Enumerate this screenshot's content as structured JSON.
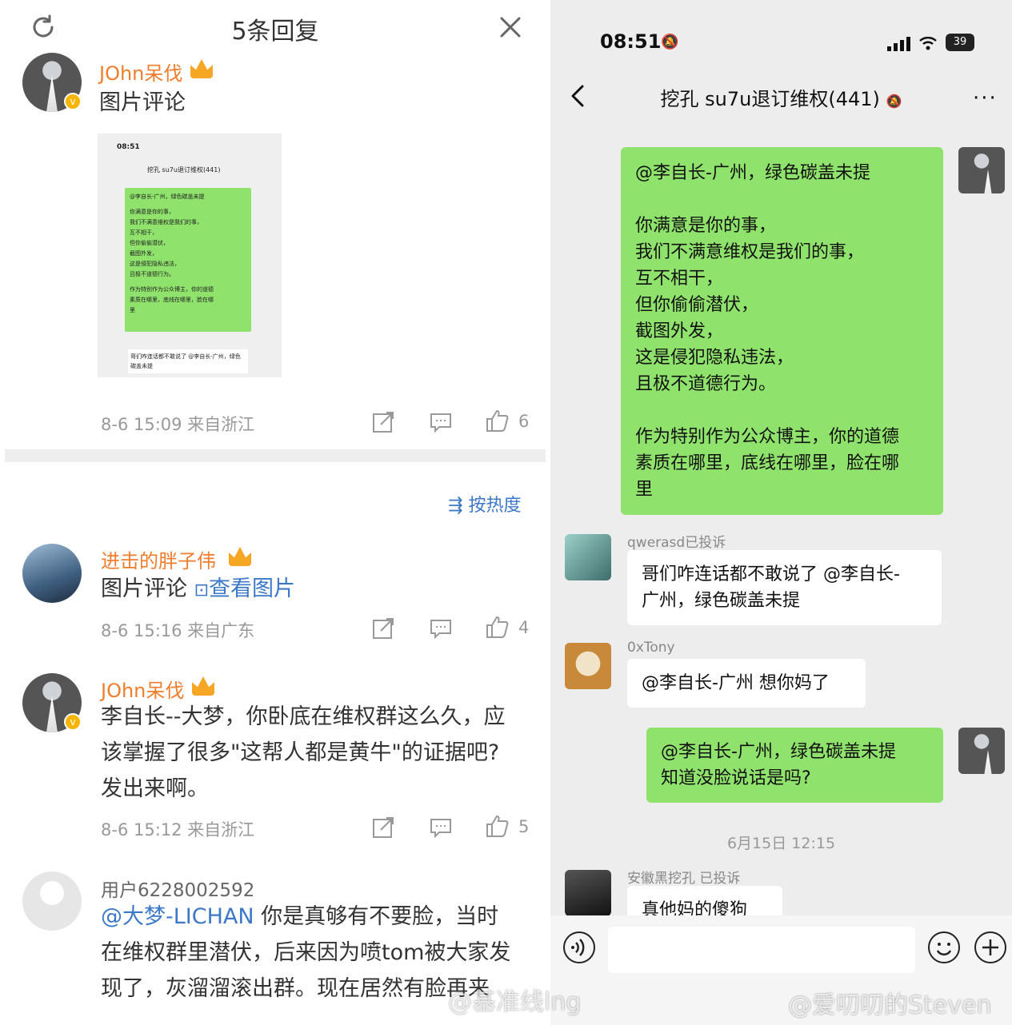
{
  "left": {
    "title": "5条回复",
    "sort_label": "按热度",
    "comments": [
      {
        "user": "JOhn呆伐",
        "text": "图片评论",
        "meta": "8-6 15:09  来自浙江",
        "likes": "6"
      },
      {
        "user": "进击的胖子伟",
        "text": "图片评论",
        "link": "查看图片",
        "meta": "8-6 15:16  来自广东",
        "likes": "4"
      },
      {
        "user": "JOhn呆伐",
        "lines": [
          "李自长--大梦，你卧底在维权群这么久，应",
          "该掌握了很多\"这帮人都是黄牛\"的证据吧?",
          "发出来啊。"
        ],
        "meta": "8-6 15:12  来自浙江",
        "likes": "5"
      },
      {
        "user": "用户6228002592",
        "mention": "@大梦-LICHAN",
        "lines": [
          "你是真够有不要脸，当时",
          "在维权群里潜伏，后来因为喷tom被大家发",
          "现了，灰溜溜滚出群。现在居然有脸再来"
        ]
      }
    ],
    "thumbnail": {
      "time": "08:51",
      "title": "挖孔 su7u退订维权(441)",
      "bubble_lines": [
        "@李自长-广州，绿色碳盖未提",
        "你满意是你的事，",
        "我们不满意维权是我们的事，",
        "互不相干，",
        "但你偷偷潜伏，",
        "截图外发，",
        "这是侵犯隐私违法，",
        "且极不道德行为。",
        "作为特别作为公众博主，你的道德",
        "素质在哪里，底线在哪里，脸在哪",
        "里"
      ],
      "reply": "哥们咋连话都不敢说了 @李自长-广州，绿色碳盖未提"
    }
  },
  "right": {
    "status_time": "08:51",
    "battery": "39",
    "chat_title": "挖孔 su7u退订维权(441)",
    "more": "···",
    "msg1_lines": [
      "@李自长-广州，绿色碳盖未提",
      "",
      "你满意是你的事，",
      "我们不满意维权是我们的事，",
      "互不相干，",
      "但你偷偷潜伏，",
      "截图外发，",
      "这是侵犯隐私违法，",
      "且极不道德行为。",
      "",
      "作为特别作为公众博主，你的道德",
      "素质在哪里，底线在哪里，脸在哪",
      "里"
    ],
    "msg2_sender": "qwerasd已投诉",
    "msg2_lines": [
      "哥们咋连话都不敢说了 @李自长-",
      "广州，绿色碳盖未提"
    ],
    "msg3_sender": "0xTony",
    "msg3_text": "@李自长-广州 想你妈了",
    "msg4_lines": [
      "@李自长-广州，绿色碳盖未提",
      "知道没脸说话是吗?"
    ],
    "timestamp": "6月15日 12:15",
    "msg5_sender": "安徽黑挖孔 已投诉",
    "msg5_text": "真他妈的傻狗"
  },
  "watermarks": {
    "left": "@基准线lng",
    "right": "@爱叨叨的Steven"
  },
  "colors": {
    "wechat_green": "#8fe36c",
    "weibo_orange": "#f07d2c",
    "weibo_link": "#3c78c8"
  }
}
